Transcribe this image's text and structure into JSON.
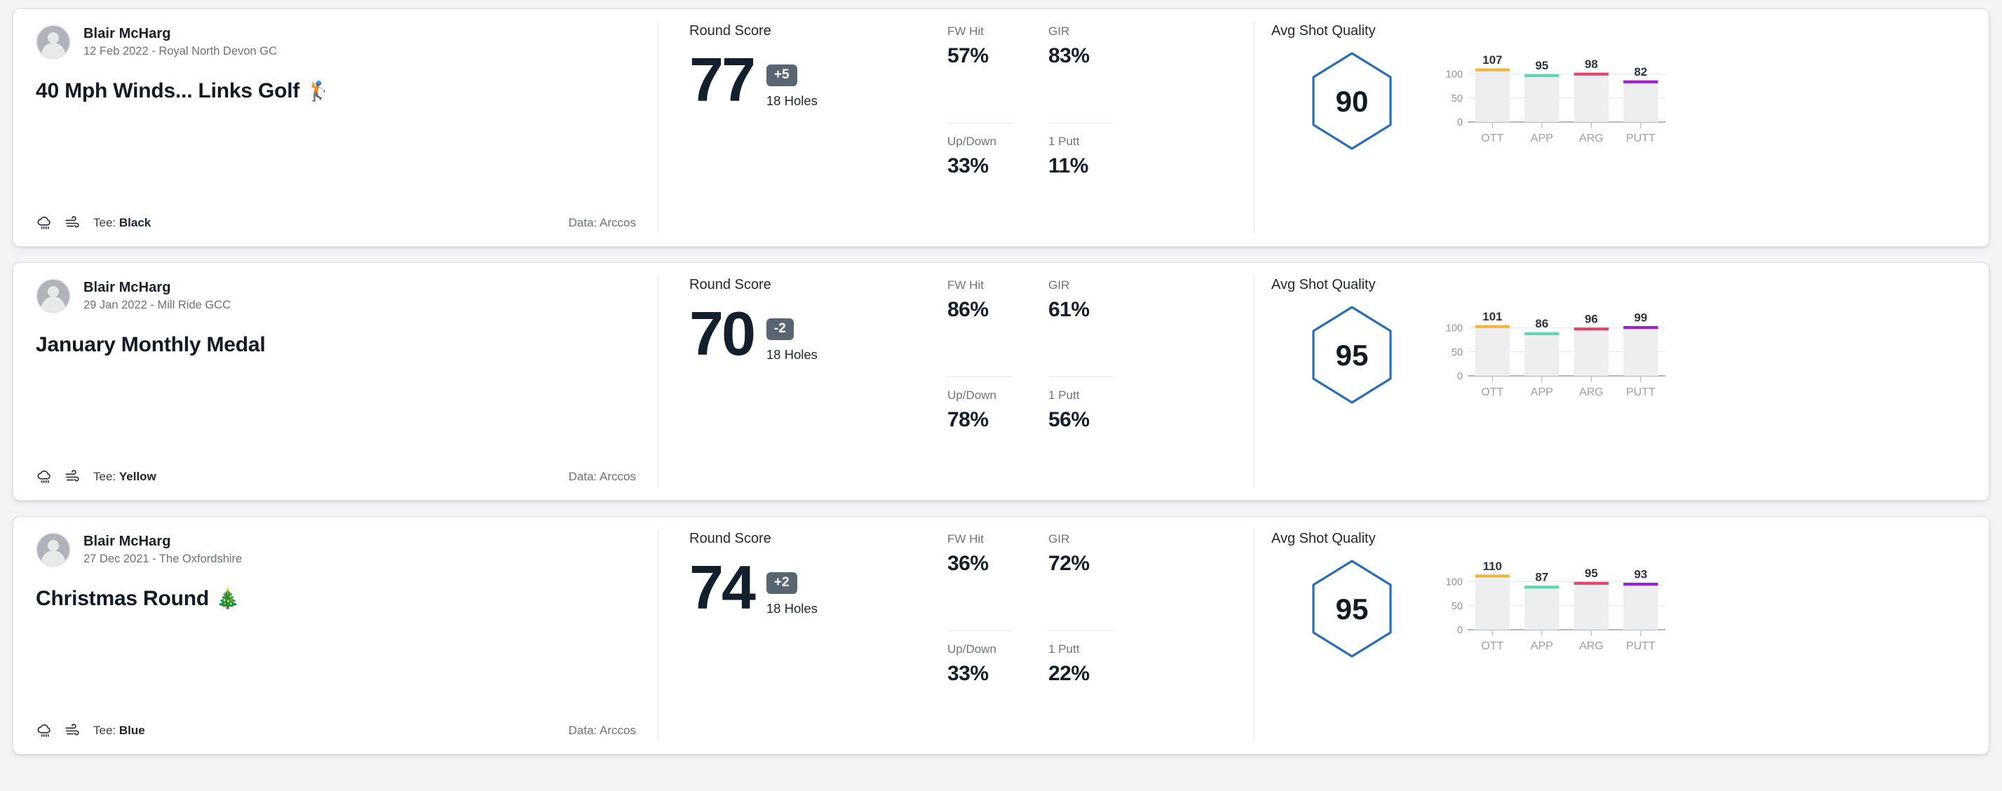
{
  "rounds": [
    {
      "player": "Blair McHarg",
      "meta": "12 Feb 2022 - Royal North Devon GC",
      "title": "40 Mph Winds... Links Golf",
      "title_emoji": "🏌️",
      "tee_prefix": "Tee:",
      "tee": "Black",
      "data_source": "Data: Arccos",
      "score_label": "Round Score",
      "score": "77",
      "to_par": "+5",
      "holes": "18 Holes",
      "stats": [
        {
          "name": "FW Hit",
          "value": "57%"
        },
        {
          "name": "GIR",
          "value": "83%"
        },
        {
          "name": "Up/Down",
          "value": "33%"
        },
        {
          "name": "1 Putt",
          "value": "11%"
        }
      ],
      "quality_label": "Avg Shot Quality",
      "quality_score": "90",
      "chart_data": {
        "type": "bar",
        "title": "Avg Shot Quality",
        "categories": [
          "OTT",
          "APP",
          "ARG",
          "PUTT"
        ],
        "values": [
          107,
          95,
          98,
          82
        ],
        "colors": [
          "#efb73e",
          "#5fd4b0",
          "#e8436a",
          "#9b1fd4"
        ],
        "yticks": [
          0,
          50,
          100
        ],
        "ylim": [
          0,
          120
        ],
        "xlabel": "",
        "ylabel": "",
        "grid": true,
        "legend": "none"
      }
    },
    {
      "player": "Blair McHarg",
      "meta": "29 Jan 2022 - Mill Ride GCC",
      "title": "January Monthly Medal",
      "title_emoji": "",
      "tee_prefix": "Tee:",
      "tee": "Yellow",
      "data_source": "Data: Arccos",
      "score_label": "Round Score",
      "score": "70",
      "to_par": "-2",
      "holes": "18 Holes",
      "stats": [
        {
          "name": "FW Hit",
          "value": "86%"
        },
        {
          "name": "GIR",
          "value": "61%"
        },
        {
          "name": "Up/Down",
          "value": "78%"
        },
        {
          "name": "1 Putt",
          "value": "56%"
        }
      ],
      "quality_label": "Avg Shot Quality",
      "quality_score": "95",
      "chart_data": {
        "type": "bar",
        "title": "Avg Shot Quality",
        "categories": [
          "OTT",
          "APP",
          "ARG",
          "PUTT"
        ],
        "values": [
          101,
          86,
          96,
          99
        ],
        "colors": [
          "#efb73e",
          "#5fd4b0",
          "#e8436a",
          "#9b1fd4"
        ],
        "yticks": [
          0,
          50,
          100
        ],
        "ylim": [
          0,
          120
        ],
        "xlabel": "",
        "ylabel": "",
        "grid": true,
        "legend": "none"
      }
    },
    {
      "player": "Blair McHarg",
      "meta": "27 Dec 2021 - The Oxfordshire",
      "title": "Christmas Round",
      "title_emoji": "🎄",
      "tee_prefix": "Tee:",
      "tee": "Blue",
      "data_source": "Data: Arccos",
      "score_label": "Round Score",
      "score": "74",
      "to_par": "+2",
      "holes": "18 Holes",
      "stats": [
        {
          "name": "FW Hit",
          "value": "36%"
        },
        {
          "name": "GIR",
          "value": "72%"
        },
        {
          "name": "Up/Down",
          "value": "33%"
        },
        {
          "name": "1 Putt",
          "value": "22%"
        }
      ],
      "quality_label": "Avg Shot Quality",
      "quality_score": "95",
      "chart_data": {
        "type": "bar",
        "title": "Avg Shot Quality",
        "categories": [
          "OTT",
          "APP",
          "ARG",
          "PUTT"
        ],
        "values": [
          110,
          87,
          95,
          93
        ],
        "colors": [
          "#efb73e",
          "#5fd4b0",
          "#e8436a",
          "#9b1fd4"
        ],
        "yticks": [
          0,
          50,
          100
        ],
        "ylim": [
          0,
          120
        ],
        "xlabel": "",
        "ylabel": "",
        "grid": true,
        "legend": "none"
      }
    }
  ],
  "theme": {
    "page_background": "#f3f4f6",
    "card_background": "#ffffff",
    "accent_blue": "#2b6cb8",
    "to_par_badge": "#5a6572",
    "text_dark": "#131f2c",
    "text_muted": "#6d757e"
  }
}
